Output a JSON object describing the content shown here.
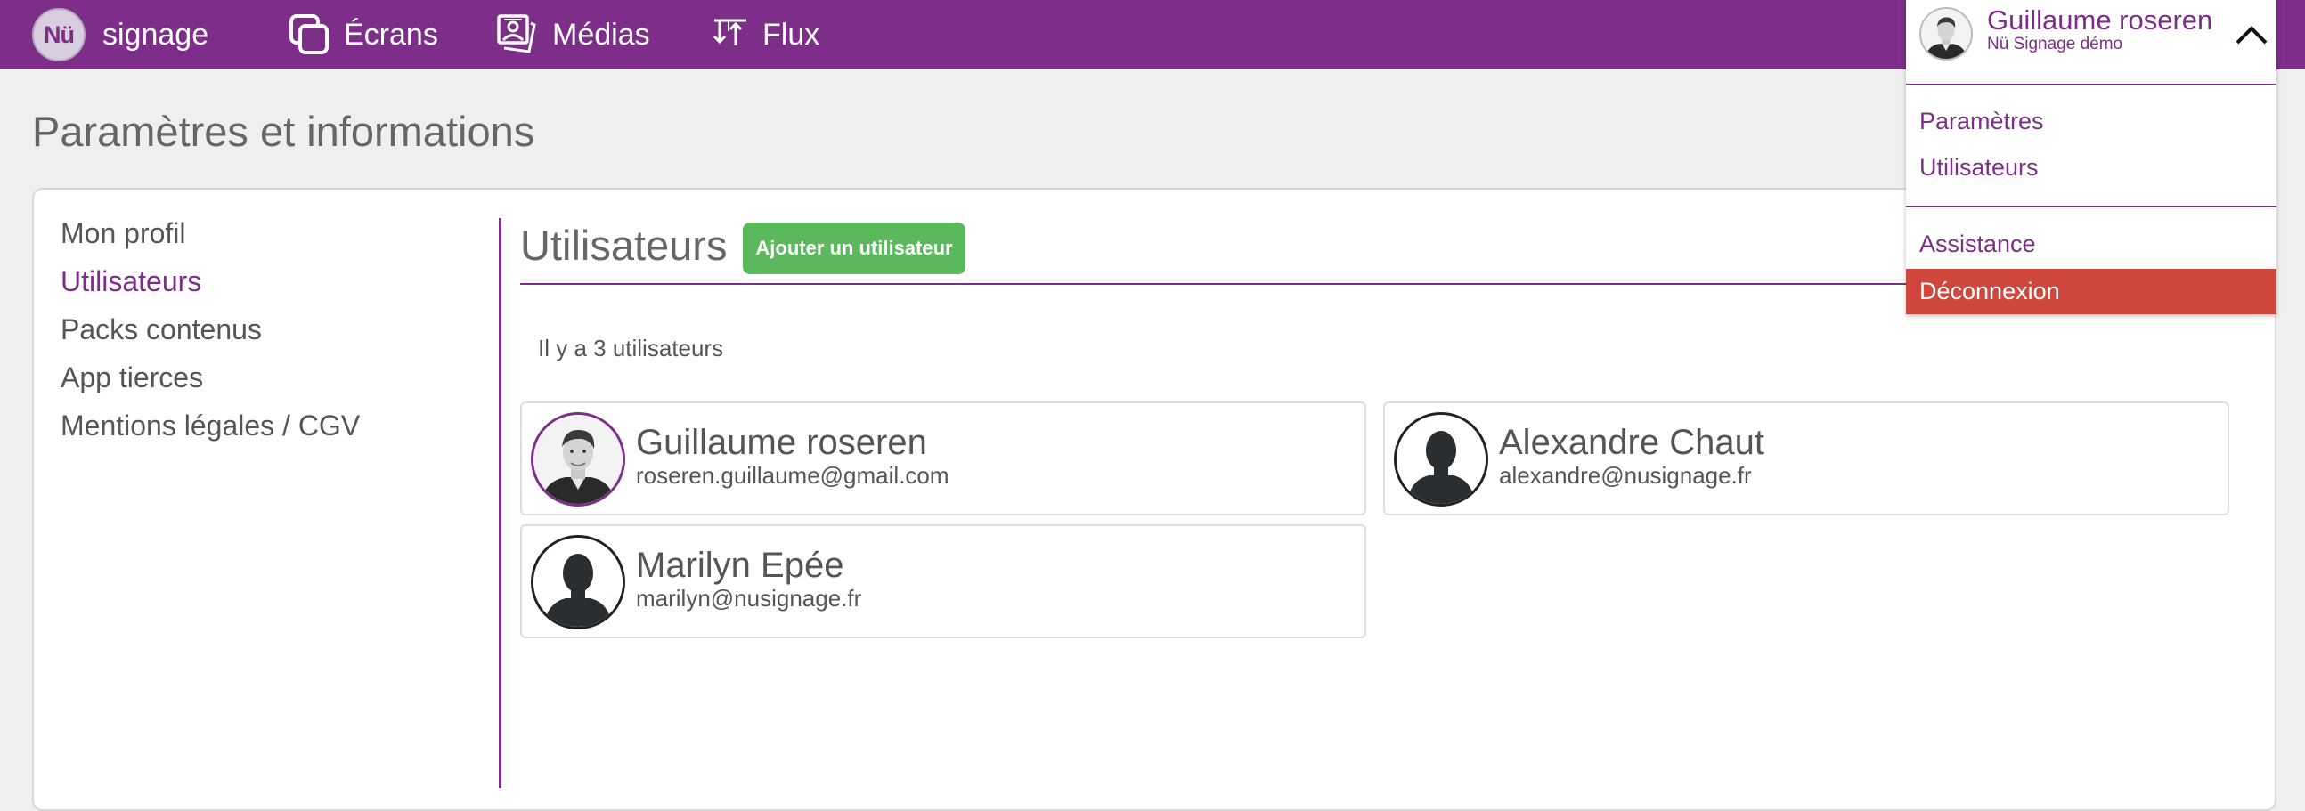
{
  "brand": {
    "logo_text": "Nü",
    "name": "signage"
  },
  "nav": {
    "screens_label": "Écrans",
    "media_label": "Médias",
    "flux_label": "Flux"
  },
  "user_menu": {
    "name": "Guillaume roseren",
    "company": "Nü Signage démo",
    "settings_label": "Paramètres",
    "users_label": "Utilisateurs",
    "support_label": "Assistance",
    "logout_label": "Déconnexion"
  },
  "page": {
    "title": "Paramètres et informations"
  },
  "sidebar": {
    "items": [
      {
        "label": "Mon profil",
        "active": false
      },
      {
        "label": "Utilisateurs",
        "active": true
      },
      {
        "label": "Packs contenus",
        "active": false
      },
      {
        "label": "App tierces",
        "active": false
      },
      {
        "label": "Mentions légales / CGV",
        "active": false
      }
    ]
  },
  "users_section": {
    "title": "Utilisateurs",
    "add_button_label": "Ajouter un utilisateur",
    "count_text": "Il y a 3 utilisateurs",
    "users": [
      {
        "name": "Guillaume roseren",
        "email": "roseren.guillaume@gmail.com",
        "avatar": "photo"
      },
      {
        "name": "Alexandre Chaut",
        "email": "alexandre@nusignage.fr",
        "avatar": "silhouette"
      },
      {
        "name": "Marilyn Epée",
        "email": "marilyn@nusignage.fr",
        "avatar": "silhouette"
      }
    ]
  },
  "colors": {
    "brand_purple": "#7c2e88",
    "success_green": "#5cb85c",
    "danger_red": "#d0473d",
    "background": "#efefef"
  },
  "icons": {
    "screens": "screens-icon",
    "media": "media-icon",
    "flux": "flux-icon",
    "toggle": "chevron-up-icon"
  }
}
